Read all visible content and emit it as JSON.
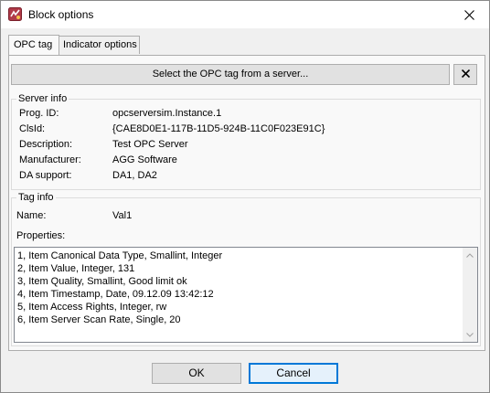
{
  "window": {
    "title": "Block options",
    "icon": "block-options-app-icon"
  },
  "tabs": [
    {
      "label": "OPC tag",
      "active": true
    },
    {
      "label": "Indicator options",
      "active": false
    }
  ],
  "opc": {
    "select_button": "Select the OPC tag from a server...",
    "clear_icon": "close-icon"
  },
  "server_info": {
    "legend": "Server info",
    "rows": [
      {
        "label": "Prog. ID:",
        "value": "opcserversim.Instance.1"
      },
      {
        "label": "ClsId:",
        "value": "{CAE8D0E1-117B-11D5-924B-11C0F023E91C}"
      },
      {
        "label": "Description:",
        "value": "Test OPC Server"
      },
      {
        "label": "Manufacturer:",
        "value": "AGG Software"
      },
      {
        "label": "DA support:",
        "value": "DA1, DA2"
      }
    ]
  },
  "tag_info": {
    "legend": "Tag info",
    "name_label": "Name:",
    "name_value": "Val1",
    "properties_label": "Properties:",
    "properties": [
      "1, Item Canonical Data Type, Smallint, Integer",
      "2, Item Value, Integer, 131",
      "3, Item Quality, Smallint, Good limit ok",
      "4, Item Timestamp, Date, 09.12.09 13:42:12",
      "5, Item Access Rights, Integer, rw",
      "6, Item Server Scan Rate, Single, 20"
    ]
  },
  "buttons": {
    "ok": "OK",
    "cancel": "Cancel"
  }
}
